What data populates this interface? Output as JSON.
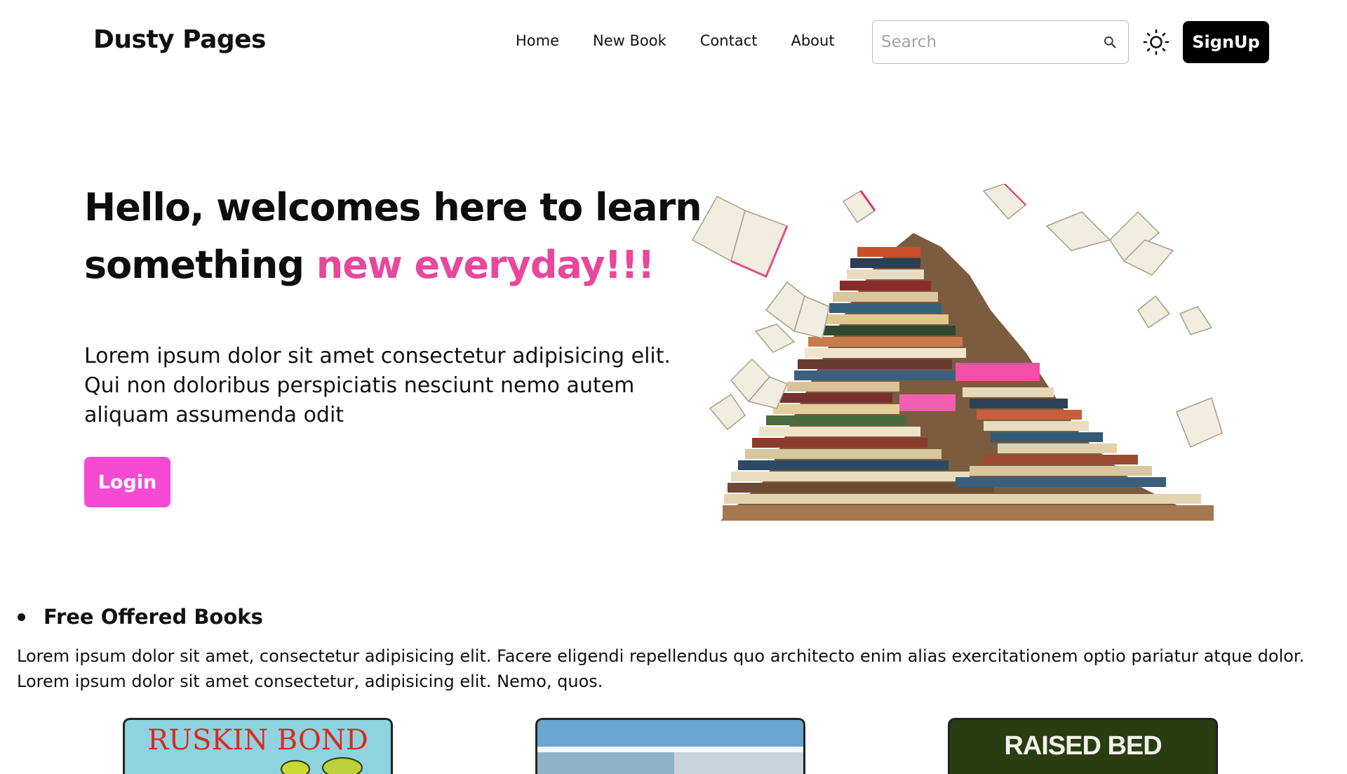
{
  "header": {
    "brand": "Dusty Pages",
    "nav": [
      "Home",
      "New Book",
      "Contact",
      "About"
    ],
    "search_placeholder": "Search",
    "signup_label": "SignUp"
  },
  "hero": {
    "title_part1": "Hello, welcomes here to learn something ",
    "title_accent": "new everyday!!!",
    "text": "Lorem ipsum dolor sit amet consectetur adipisicing elit. Qui non doloribus perspiciatis nesciunt nemo autem aliquam assumenda odit",
    "login_label": "Login"
  },
  "free_books": {
    "heading": "Free Offered Books",
    "text": "Lorem ipsum dolor sit amet, consectetur adipisicing elit. Facere eligendi repellendus quo architecto enim alias exercitationem optio pariatur atque dolor. Lorem ipsum dolor sit amet consectetur, adipisicing elit. Nemo, quos.",
    "cards": [
      {
        "title": "RUSKIN BOND"
      },
      {
        "title": ""
      },
      {
        "title": "RAISED BED"
      }
    ]
  },
  "colors": {
    "accent_pink": "#e8479c",
    "login_bg": "#f74ad2",
    "signup_bg": "#000000"
  },
  "icons": {
    "search": "search-icon",
    "theme": "sun-icon"
  }
}
